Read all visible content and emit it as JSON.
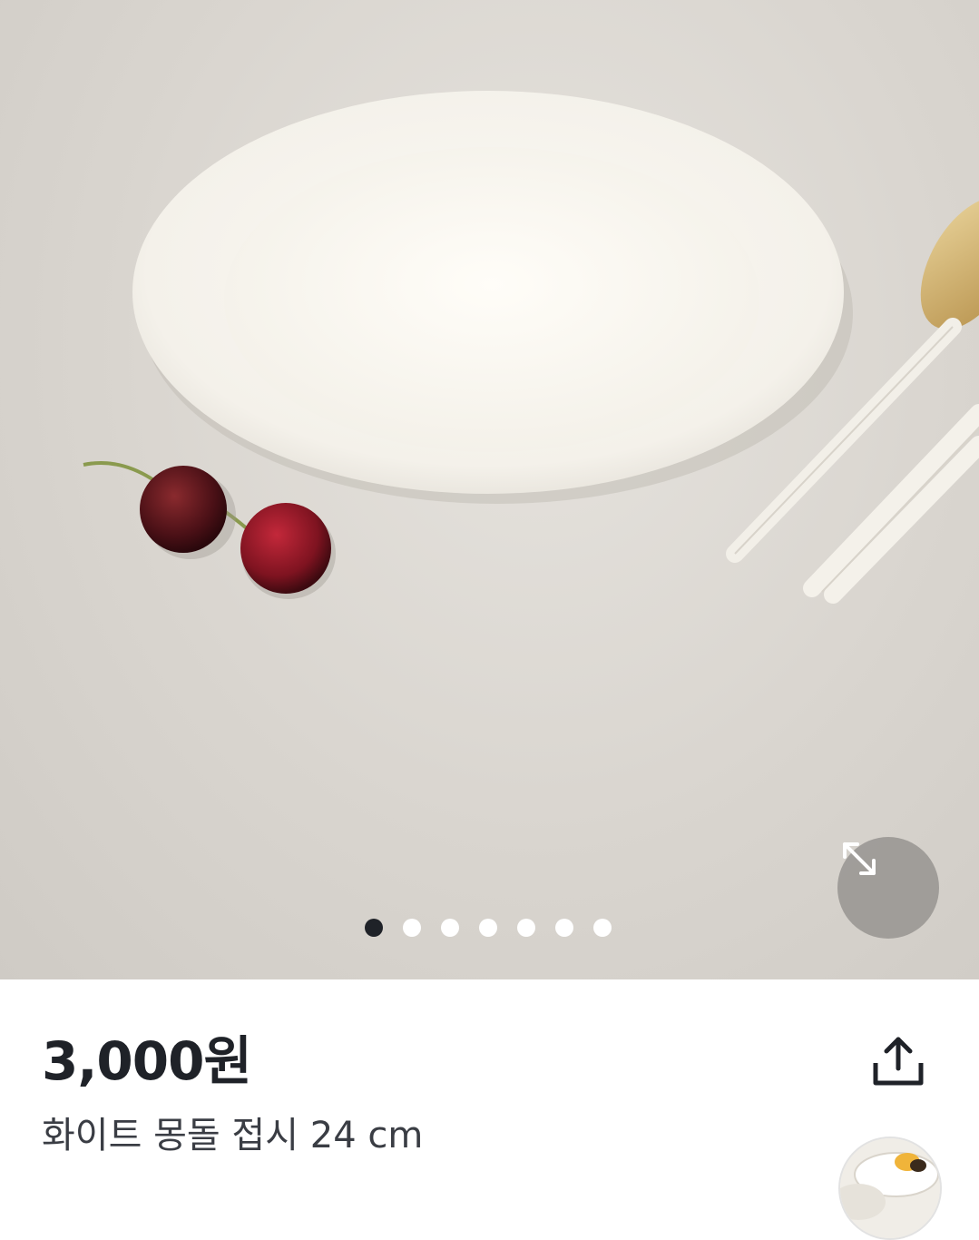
{
  "product": {
    "price": "3,000원",
    "title": "화이트 몽돌 접시 24 cm"
  },
  "gallery": {
    "image_count": 7,
    "active_index": 0,
    "image_subject": "plate-photo"
  },
  "icons": {
    "expand": "expand-icon",
    "share": "share-icon"
  },
  "colors": {
    "price_text": "#1f2228",
    "active_dot": "#1f2228",
    "inactive_dot": "#ffffff",
    "expand_button_bg": "#96948f"
  }
}
